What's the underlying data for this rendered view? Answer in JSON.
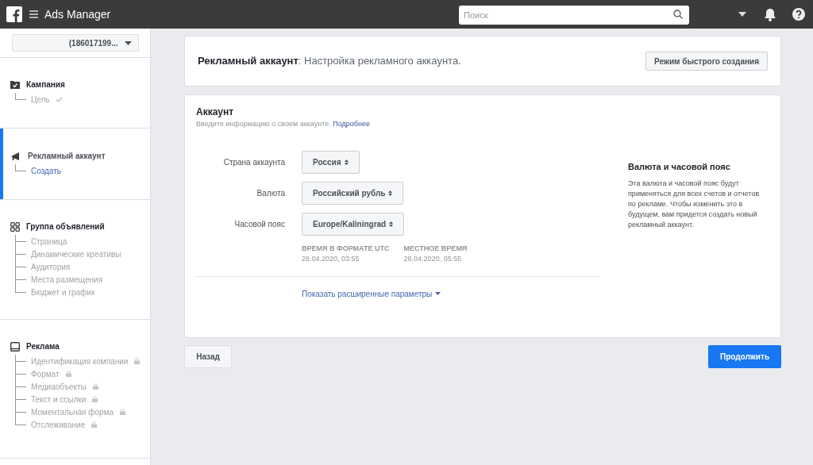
{
  "top_bar": {
    "app_name": "Ads Manager",
    "search": {
      "placeholder": "Поиск"
    }
  },
  "sidebar": {
    "account_selector": "(186017199...",
    "sections": [
      {
        "kind": "campaign",
        "title": "Кампания",
        "selected": false,
        "children": [
          {
            "label": "Цель",
            "checked": true,
            "selected": false,
            "locked": false
          }
        ]
      },
      {
        "kind": "account",
        "title": "Рекламный аккаунт",
        "selected": true,
        "children": [
          {
            "label": "Создать",
            "checked": false,
            "selected": true,
            "locked": false
          }
        ]
      },
      {
        "kind": "adset",
        "title": "Группа объявлений",
        "selected": false,
        "children": [
          {
            "label": "Страница",
            "checked": false,
            "selected": false,
            "locked": false
          },
          {
            "label": "Динамические креативы",
            "checked": false,
            "selected": false,
            "locked": false
          },
          {
            "label": "Аудитория",
            "checked": false,
            "selected": false,
            "locked": false
          },
          {
            "label": "Места размещения",
            "checked": false,
            "selected": false,
            "locked": false
          },
          {
            "label": "Бюджет и график",
            "checked": false,
            "selected": false,
            "locked": false
          }
        ]
      },
      {
        "kind": "ad",
        "title": "Реклама",
        "selected": false,
        "children": [
          {
            "label": "Идентификация компании",
            "checked": false,
            "selected": false,
            "locked": true
          },
          {
            "label": "Формат",
            "checked": false,
            "selected": false,
            "locked": true
          },
          {
            "label": "Медиаобъекты",
            "checked": false,
            "selected": false,
            "locked": true
          },
          {
            "label": "Текст и ссылки",
            "checked": false,
            "selected": false,
            "locked": true
          },
          {
            "label": "Моментальная форма",
            "checked": false,
            "selected": false,
            "locked": true
          },
          {
            "label": "Отслеживание",
            "checked": false,
            "selected": false,
            "locked": true
          }
        ]
      }
    ]
  },
  "header_card": {
    "title": "**Рекламный аккаунт**: Настройка рекламного аккаунта.",
    "quick_mode_button": "Режим быстрого создания"
  },
  "account_card": {
    "title": "Аккаунт",
    "subtitle": "Введите информацию о своем аккаунте.",
    "link": "Подробнее",
    "fields": [
      {
        "label": "Страна аккаунта",
        "value": "Россия"
      },
      {
        "label": "Валюта",
        "value": "Российский рубль"
      },
      {
        "label": "Часовой пояс",
        "value": "Europe/Kaliningrad"
      }
    ],
    "times": [
      {
        "heading": "ВРЕМЯ В ФОРМАТЕ UTC",
        "value": "28.04.2020, 03:55"
      },
      {
        "heading": "МЕСТНОЕ ВРЕМЯ",
        "value": "28.04.2020, 05:55"
      }
    ],
    "advanced_link": "Показать расширенные параметры",
    "info": {
      "title": "Валюта и часовой пояс",
      "text": "Эта валюта и часовой пояс будут применяться для всех счетов и отчетов по рекламе. Чтобы изменить это в будущем, вам придется создать новый рекламный аккаунт."
    }
  },
  "buttons": {
    "back": "Назад",
    "continue": "Продолжить"
  }
}
